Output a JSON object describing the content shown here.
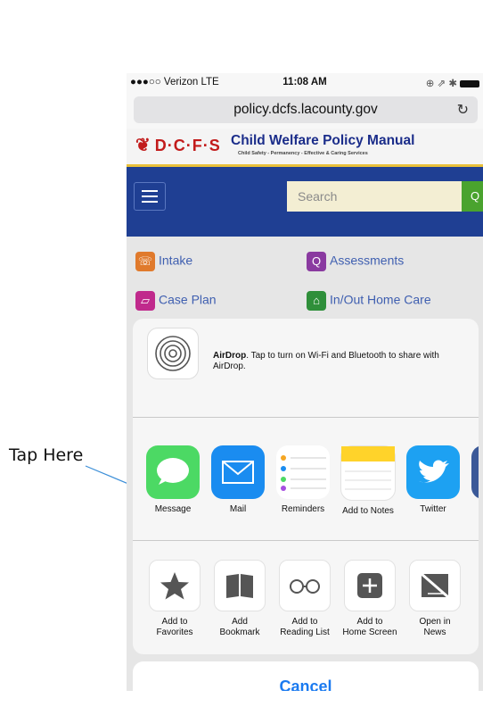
{
  "annotation": {
    "label": "Tap Here"
  },
  "status_bar": {
    "carrier": "●●●○○ Verizon  LTE",
    "time": "11:08 AM",
    "right": "⊕ ⇗ ✱"
  },
  "browser": {
    "url": "policy.dcfs.lacounty.gov",
    "reload_icon": "reload-icon"
  },
  "site": {
    "logo": "D·C·F·S",
    "title": "Child Welfare Policy Manual",
    "tagline": "Child Safety - Permanency - Effective & Caring Services",
    "search_placeholder": "Search",
    "links": [
      {
        "label": "Intake",
        "color": "#e07a2c"
      },
      {
        "label": "Assessments",
        "color": "#8a3aa0"
      },
      {
        "label": "Case Plan",
        "color": "#c02a8c"
      },
      {
        "label": "In/Out Home Care",
        "color": "#2f8f3a"
      }
    ]
  },
  "share_sheet": {
    "airdrop_bold": "AirDrop",
    "airdrop_text": ". Tap to turn on Wi-Fi and Bluetooth to share with AirDrop.",
    "apps": [
      {
        "label": "Message",
        "icon": "message-icon",
        "color": "#4cd964"
      },
      {
        "label": "Mail",
        "icon": "mail-icon",
        "color": "#1a8cf0"
      },
      {
        "label": "Reminders",
        "icon": "reminders-icon",
        "color": "#ffffff"
      },
      {
        "label": "Add to Notes",
        "icon": "notes-icon",
        "color": "#ffd32a"
      },
      {
        "label": "Twitter",
        "icon": "twitter-icon",
        "color": "#1da1f2"
      },
      {
        "label": "F",
        "icon": "facebook-icon",
        "color": "#3b5998"
      }
    ],
    "actions": [
      {
        "label": "Add to\nFavorites",
        "icon": "star-icon"
      },
      {
        "label": "Add\nBookmark",
        "icon": "book-icon"
      },
      {
        "label": "Add to\nReading List",
        "icon": "glasses-icon"
      },
      {
        "label": "Add to\nHome Screen",
        "icon": "plus-icon"
      },
      {
        "label": "Open in\nNews",
        "icon": "news-icon"
      }
    ],
    "cancel": "Cancel"
  }
}
